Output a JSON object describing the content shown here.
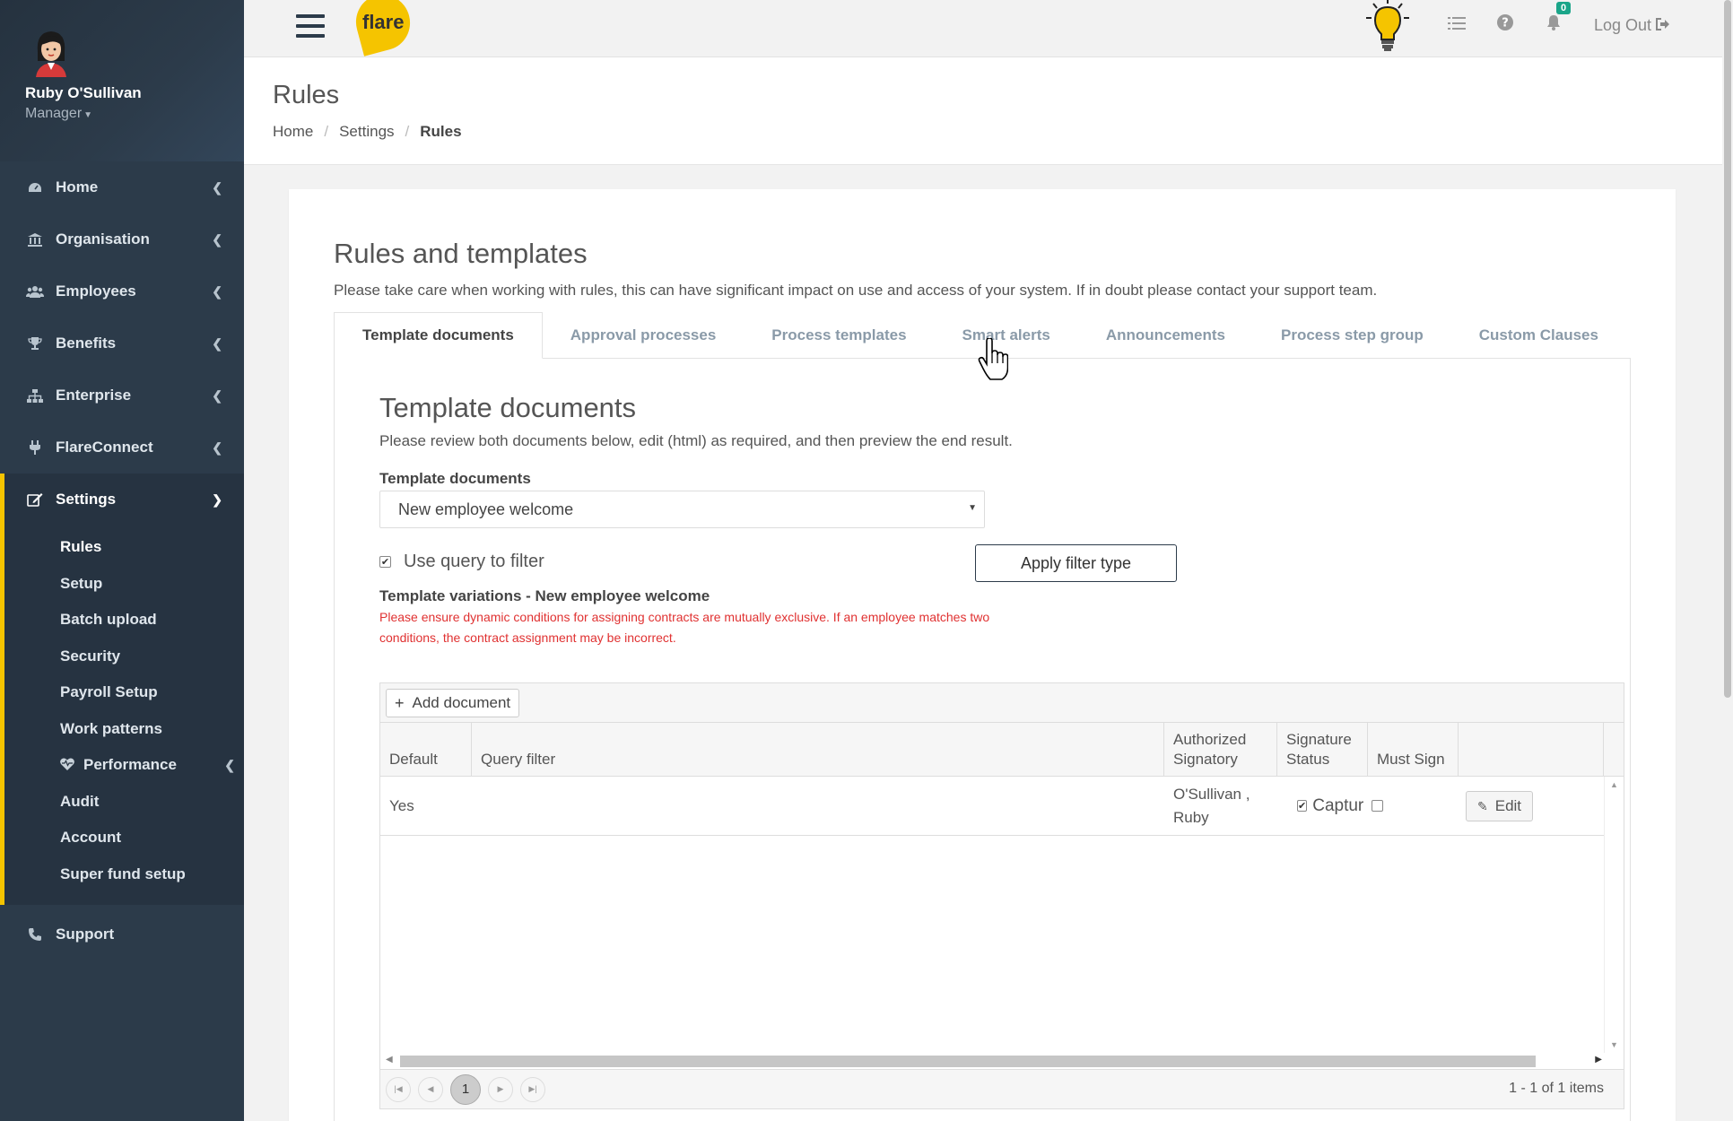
{
  "profile": {
    "name": "Ruby O'Sullivan",
    "role": "Manager"
  },
  "sidebar": {
    "items": [
      {
        "label": "Home",
        "icon": "dashboard-icon"
      },
      {
        "label": "Organisation",
        "icon": "bank-icon"
      },
      {
        "label": "Employees",
        "icon": "users-icon"
      },
      {
        "label": "Benefits",
        "icon": "trophy-icon"
      },
      {
        "label": "Enterprise",
        "icon": "sitemap-icon"
      },
      {
        "label": "FlareConnect",
        "icon": "plug-icon"
      },
      {
        "label": "Settings",
        "icon": "edit-icon"
      }
    ],
    "settings_sub": [
      "Rules",
      "Setup",
      "Batch upload",
      "Security",
      "Payroll Setup",
      "Work patterns",
      "Performance",
      "Audit",
      "Account",
      "Super fund setup"
    ],
    "support": "Support"
  },
  "topbar": {
    "logo_text": "flare",
    "notification_count": "0",
    "logout_label": "Log Out",
    "accent": "#f5c400",
    "badge_color": "#1aa589"
  },
  "page": {
    "title": "Rules",
    "breadcrumb": [
      "Home",
      "Settings",
      "Rules"
    ]
  },
  "card": {
    "title": "Rules and templates",
    "description": "Please take care when working with rules, this can have significant impact on use and access of your system. If in doubt please contact your support team.",
    "tabs": [
      "Template documents",
      "Approval processes",
      "Process templates",
      "Smart alerts",
      "Announcements",
      "Process step group",
      "Custom Clauses"
    ]
  },
  "panel": {
    "title": "Template documents",
    "description": "Please review both documents below, edit (html) as required, and then preview the end result.",
    "field_label": "Template documents",
    "select_value": "New employee welcome",
    "use_query_label": "Use query to filter",
    "use_query_checked": true,
    "apply_label": "Apply filter type",
    "variations_title": "Template variations - New employee welcome",
    "warning": "Please ensure dynamic conditions for assigning contracts are mutually exclusive. If an employee matches two conditions, the contract assignment may be incorrect.",
    "warning_color": "#e03131"
  },
  "grid": {
    "add_label": "Add document",
    "columns": [
      "Default",
      "Query filter",
      "Authorized Signatory",
      "Signature Status",
      "Must Sign"
    ],
    "rows": [
      {
        "default": "Yes",
        "query": "",
        "signatory": "O'Sullivan , Ruby",
        "signature_status": "Captur",
        "signature_checked": true,
        "must_sign": false,
        "action": "Edit"
      }
    ],
    "current_page": "1",
    "pager_info": "1 - 1 of 1 items"
  }
}
